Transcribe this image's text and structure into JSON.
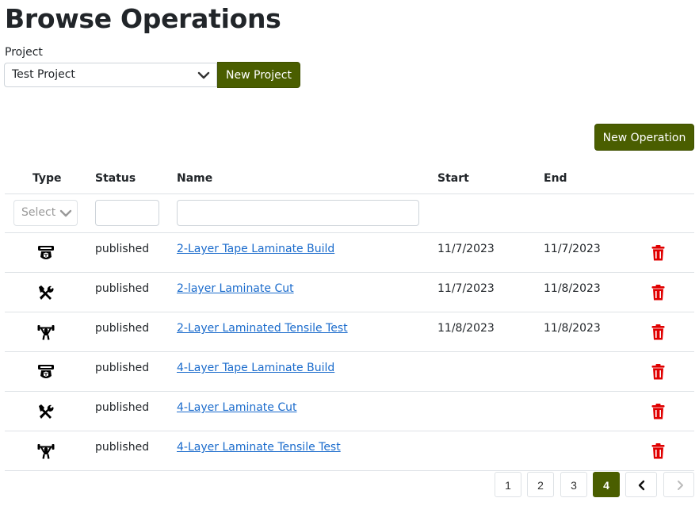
{
  "page": {
    "title": "Browse Operations"
  },
  "project": {
    "label": "Project",
    "selected": "Test Project",
    "new_project_label": "New Project"
  },
  "new_operation_label": "New Operation",
  "table": {
    "headers": {
      "type": "Type",
      "status": "Status",
      "name": "Name",
      "start": "Start",
      "end": "End"
    },
    "filters": {
      "type_placeholder": "Select"
    },
    "rows": [
      {
        "type_icon": "build-plate-icon",
        "status": "published",
        "name": "2-Layer Tape Laminate Build",
        "start": "11/7/2023",
        "end": "11/7/2023"
      },
      {
        "type_icon": "tools-icon",
        "status": "published",
        "name": "2-layer Laminate Cut",
        "start": "11/7/2023",
        "end": "11/8/2023"
      },
      {
        "type_icon": "tensile-test-icon",
        "status": "published",
        "name": "2-Layer Laminated Tensile Test",
        "start": "11/8/2023",
        "end": "11/8/2023"
      },
      {
        "type_icon": "build-plate-icon",
        "status": "published",
        "name": "4-Layer Tape Laminate Build",
        "start": "",
        "end": ""
      },
      {
        "type_icon": "tools-icon",
        "status": "published",
        "name": "4-Layer Laminate Cut",
        "start": "",
        "end": ""
      },
      {
        "type_icon": "tensile-test-icon",
        "status": "published",
        "name": "4-Layer Laminate Tensile Test",
        "start": "",
        "end": ""
      }
    ]
  },
  "pagination": {
    "pages": [
      "1",
      "2",
      "3",
      "4"
    ],
    "current": "4"
  },
  "colors": {
    "accent": "#4a5e00",
    "link": "#1a6bcc",
    "delete": "#e00000"
  }
}
